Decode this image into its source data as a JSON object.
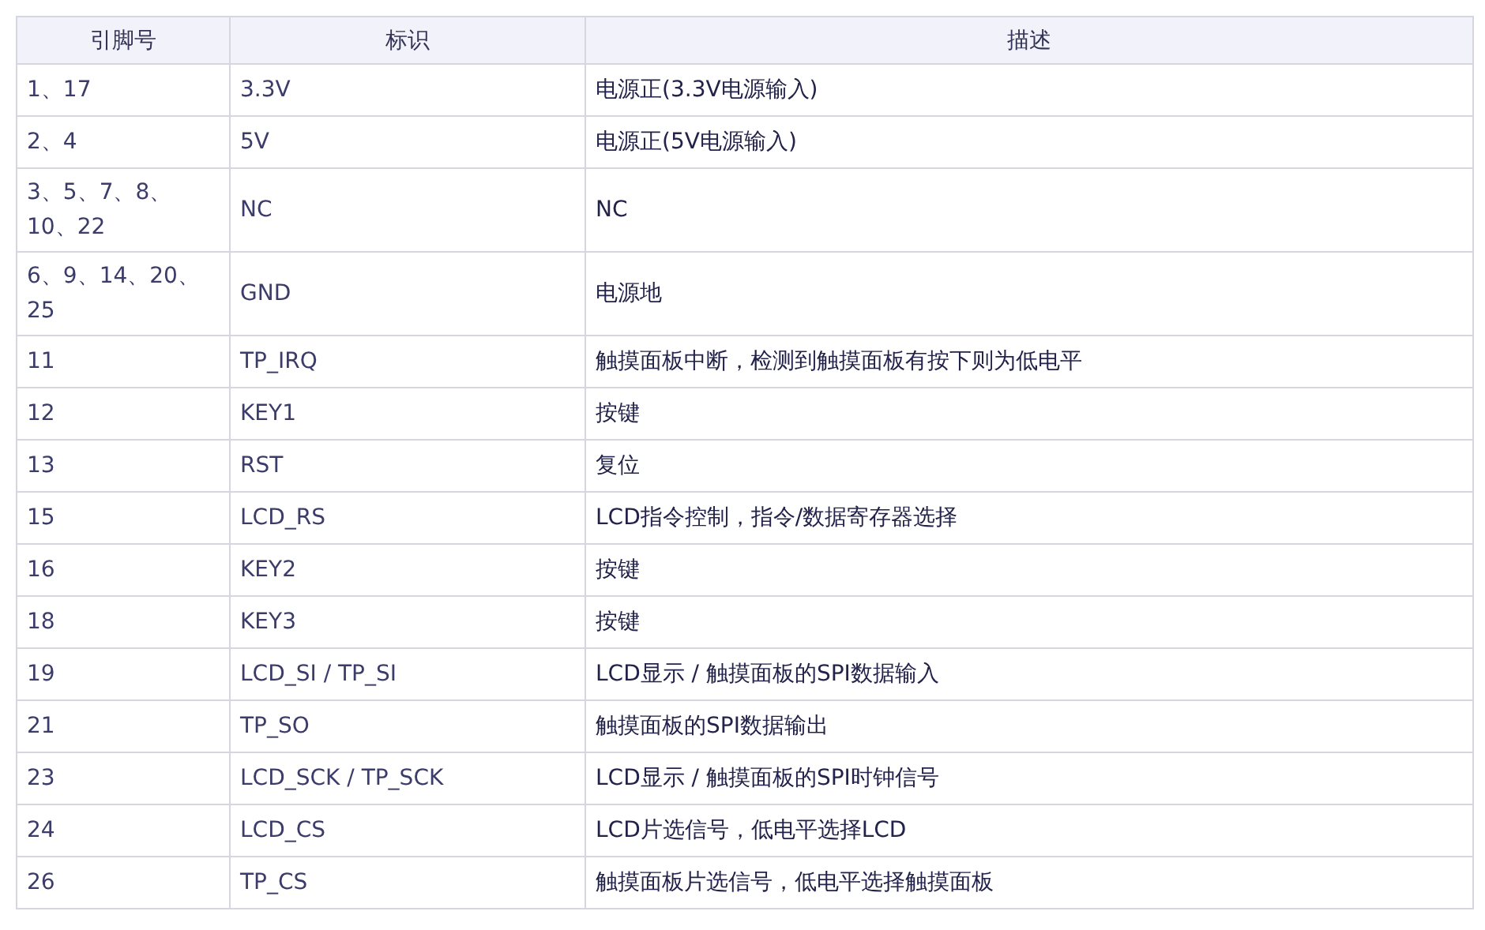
{
  "table": {
    "columns": [
      "引脚号",
      "标识",
      "描述"
    ],
    "rows": [
      [
        "1、17",
        "3.3V",
        "电源正(3.3V电源输入)"
      ],
      [
        "2、4",
        "5V",
        "电源正(5V电源输入)"
      ],
      [
        "3、5、7、8、10、22",
        "NC",
        "NC"
      ],
      [
        "6、9、14、20、25",
        "GND",
        "电源地"
      ],
      [
        "11",
        "TP_IRQ",
        "触摸面板中断，检测到触摸面板有按下则为低电平"
      ],
      [
        "12",
        "KEY1",
        "按键"
      ],
      [
        "13",
        "RST",
        "复位"
      ],
      [
        "15",
        "LCD_RS",
        "LCD指令控制，指令/数据寄存器选择"
      ],
      [
        "16",
        "KEY2",
        "按键"
      ],
      [
        "18",
        "KEY3",
        "按键"
      ],
      [
        "19",
        "LCD_SI / TP_SI",
        "LCD显示 / 触摸面板的SPI数据输入"
      ],
      [
        "21",
        "TP_SO",
        "触摸面板的SPI数据输出"
      ],
      [
        "23",
        "LCD_SCK / TP_SCK",
        "LCD显示 / 触摸面板的SPI时钟信号"
      ],
      [
        "24",
        "LCD_CS",
        "LCD片选信号，低电平选择LCD"
      ],
      [
        "26",
        "TP_CS",
        "触摸面板片选信号，低电平选择触摸面板"
      ]
    ]
  }
}
